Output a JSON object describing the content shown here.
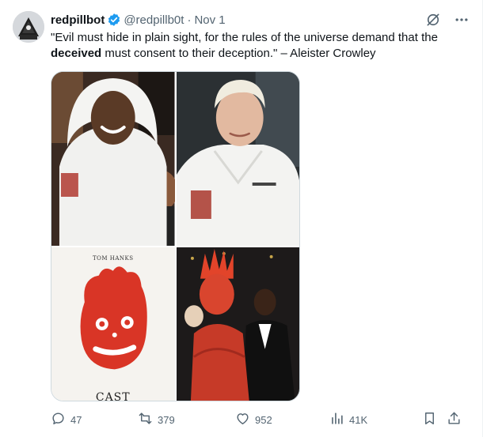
{
  "author": {
    "display_name": "redpillbot",
    "handle": "@redpillb0t",
    "separator": "·",
    "date": "Nov 1",
    "verified": true
  },
  "tweet": {
    "text_before": "\"Evil must hide in plain sight, for the rules of the universe demand that the ",
    "text_bold": "deceived",
    "text_after": " must consent to their deception.\" – Aleister Crowley"
  },
  "media": {
    "panel_3_title": "TOM HANKS",
    "panel_3_caption": "CAST"
  },
  "stats": {
    "replies": "47",
    "reposts": "379",
    "likes": "952",
    "views": "41K"
  },
  "colors": {
    "text_primary": "#0f1419",
    "text_secondary": "#536471",
    "verified_blue": "#1d9bf0",
    "border": "#cfd9de"
  },
  "icons": {
    "verified": "verified-badge-icon",
    "grok": "grok-icon",
    "more": "more-icon",
    "reply": "reply-icon",
    "repost": "repost-icon",
    "like": "like-icon",
    "views": "views-icon",
    "bookmark": "bookmark-icon",
    "share": "share-icon"
  }
}
